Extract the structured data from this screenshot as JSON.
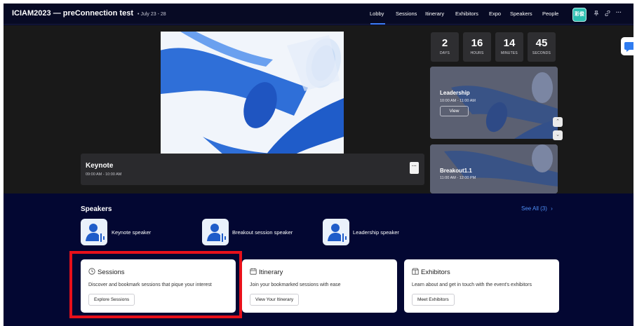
{
  "header": {
    "event_title": "ICIAM2023 — preConnection test",
    "event_dates": "• July 23 - 28",
    "nav": [
      "Lobby",
      "Sessions",
      "Itinerary",
      "Exhibitors",
      "Expo",
      "Speakers",
      "People"
    ],
    "active_nav": "Lobby",
    "user_chip": "彩俊",
    "icons": [
      "pin-icon",
      "link-icon",
      "more-icon"
    ]
  },
  "stage": {
    "keynote_title": "Keynote",
    "keynote_time": "09:00 AM - 10:00 AM",
    "more_label": "···",
    "countdown": [
      {
        "value": "2",
        "label": "DAYS"
      },
      {
        "value": "16",
        "label": "HOURS"
      },
      {
        "value": "14",
        "label": "MINUTES"
      },
      {
        "value": "45",
        "label": "SECONDS"
      }
    ],
    "upcoming": [
      {
        "title": "Leadership",
        "time": "10:00 AM - 11:00 AM",
        "button": "View"
      },
      {
        "title": "Breakout1.1",
        "time": "11:00 AM - 12:00 PM"
      }
    ]
  },
  "speakers": {
    "heading": "Speakers",
    "see_all": "See All (3)",
    "see_all_arrow": "›",
    "items": [
      "Keynote speaker",
      "Breakout session speaker",
      "Leadership speaker"
    ]
  },
  "cards": [
    {
      "title": "Sessions",
      "icon": "clock-icon",
      "description": "Discover and bookmark sessions that pique your interest",
      "button": "Explore Sessions"
    },
    {
      "title": "Itinerary",
      "icon": "calendar-icon",
      "description": "Join your bookmarked sessions with ease",
      "button": "View Your Itinerary"
    },
    {
      "title": "Exhibitors",
      "icon": "booth-icon",
      "description": "Learn about and get in touch with the event's exhibitors",
      "button": "Meet Exhibitors"
    }
  ],
  "colors": {
    "background": "#030732",
    "stage": "#191919",
    "accent": "#3d7cf4",
    "highlight": "#e8101a"
  }
}
